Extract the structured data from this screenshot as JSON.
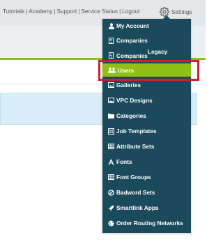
{
  "header": {
    "links": [
      "Tutorials",
      "Academy",
      "Support",
      "Service Status",
      "Logout"
    ],
    "separator": "|",
    "settings_label": "Settings",
    "settings_icon": "gear-icon"
  },
  "menu": {
    "legacy_label": "Legacy",
    "items": [
      {
        "label": "My Account",
        "icon": "user-icon"
      },
      {
        "label": "Companies",
        "icon": "building-icon"
      },
      {
        "label": "Companies",
        "icon": "building-icon"
      },
      {
        "label": "Users",
        "icon": "users-icon",
        "active": true
      },
      {
        "label": "Galleries",
        "icon": "image-icon"
      },
      {
        "label": "VPC Designs",
        "icon": "image-icon"
      },
      {
        "label": "Categories",
        "icon": "folder-icon"
      },
      {
        "label": "Job Templates",
        "icon": "template-icon"
      },
      {
        "label": "Attribute Sets",
        "icon": "grid-icon"
      },
      {
        "label": "Fonts",
        "icon": "font-icon"
      },
      {
        "label": "Font Groups",
        "icon": "grid-icon"
      },
      {
        "label": "Badword Sets",
        "icon": "ban-icon"
      },
      {
        "label": "Smartlink Apps",
        "icon": "rocket-icon"
      },
      {
        "label": "Order Routing Networks",
        "icon": "globe-icon"
      }
    ]
  },
  "colors": {
    "menu_bg": "#1a4a5c",
    "active_bg": "#93be13",
    "highlight_border": "#d01f26",
    "accent_line": "#8fbe1c"
  }
}
